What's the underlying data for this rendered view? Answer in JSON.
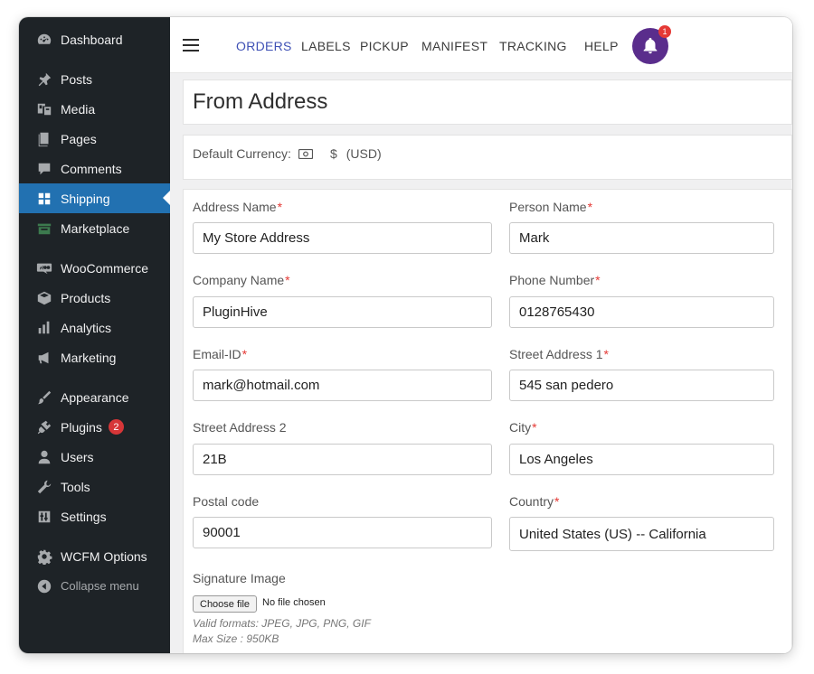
{
  "sidebar": {
    "items": [
      {
        "label": "Dashboard",
        "icon": "dashboard-icon"
      },
      {
        "label": "Posts",
        "icon": "pin-icon"
      },
      {
        "label": "Media",
        "icon": "media-icon"
      },
      {
        "label": "Pages",
        "icon": "pages-icon"
      },
      {
        "label": "Comments",
        "icon": "comment-icon"
      },
      {
        "label": "Shipping",
        "icon": "grid-icon",
        "active": true
      },
      {
        "label": "Marketplace",
        "icon": "marketplace-icon"
      },
      {
        "label": "WooCommerce",
        "icon": "woo-icon"
      },
      {
        "label": "Products",
        "icon": "box-icon"
      },
      {
        "label": "Analytics",
        "icon": "bar-chart-icon"
      },
      {
        "label": "Marketing",
        "icon": "megaphone-icon"
      },
      {
        "label": "Appearance",
        "icon": "paintbrush-icon"
      },
      {
        "label": "Plugins",
        "icon": "plug-icon",
        "badge": "2"
      },
      {
        "label": "Users",
        "icon": "user-icon"
      },
      {
        "label": "Tools",
        "icon": "wrench-icon"
      },
      {
        "label": "Settings",
        "icon": "sliders-icon"
      },
      {
        "label": "WCFM Options",
        "icon": "gear-icon"
      },
      {
        "label": "Collapse menu",
        "icon": "collapse-icon"
      }
    ]
  },
  "topnav": {
    "links": [
      "ORDERS",
      "LABELS",
      "PICKUP",
      "MANIFEST",
      "TRACKING",
      "HELP"
    ],
    "active": "ORDERS",
    "notification_count": "1",
    "bell_color": "#5a2d8c"
  },
  "page": {
    "title": "From Address",
    "currency_label": "Default Currency:",
    "currency_symbol": "$",
    "currency_code": "(USD)"
  },
  "form": {
    "address_name": {
      "label": "Address Name",
      "value": "My Store Address",
      "required": true
    },
    "person_name": {
      "label": "Person Name",
      "value": "Mark",
      "required": true
    },
    "company_name": {
      "label": "Company Name",
      "value": "PluginHive",
      "required": true
    },
    "phone_number": {
      "label": "Phone Number",
      "value": "0128765430",
      "required": true
    },
    "email": {
      "label": "Email-ID",
      "value": "mark@hotmail.com",
      "required": true
    },
    "street_1": {
      "label": "Street Address 1",
      "value": "545 san pedero",
      "required": true
    },
    "street_2": {
      "label": "Street Address 2",
      "value": "21B",
      "required": false
    },
    "city": {
      "label": "City",
      "value": "Los Angeles",
      "required": true
    },
    "postal_code": {
      "label": "Postal code",
      "value": "90001",
      "required": false
    },
    "country": {
      "label": "Country",
      "value": "United States (US) -- California",
      "required": true
    },
    "signature": {
      "label": "Signature Image",
      "button": "Choose file",
      "status": "No file chosen",
      "formats": "Valid formats: JPEG, JPG, PNG, GIF",
      "max_size": "Max Size : 950KB"
    }
  },
  "colors": {
    "sidebar_bg": "#1e2327",
    "active_bg": "#2271b1",
    "required": "#e53935",
    "nav_active": "#3f51b5"
  }
}
